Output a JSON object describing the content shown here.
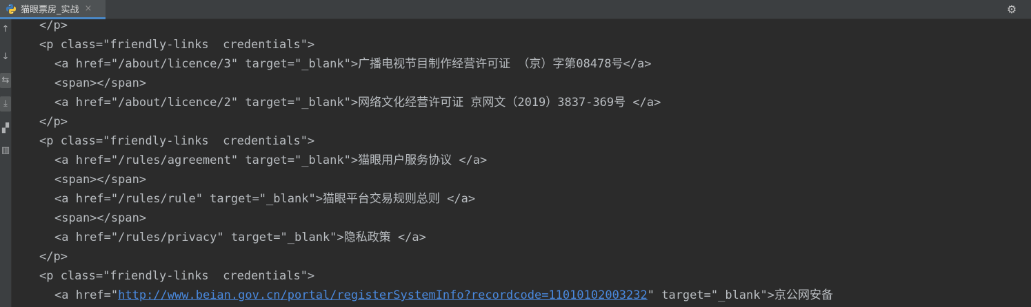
{
  "tab": {
    "title": "猫眼票房_实战",
    "close": "×",
    "icon": "python-icon"
  },
  "toolbar": {
    "settings_icon": "⚙"
  },
  "sidebar": {
    "buttons": [
      {
        "name": "scroll-up-icon",
        "glyph": "↑"
      },
      {
        "name": "scroll-down-icon",
        "glyph": "↓"
      },
      {
        "name": "soft-wrap-icon",
        "glyph": "⇆"
      },
      {
        "name": "scroll-to-end-icon",
        "glyph": "⤓"
      },
      {
        "name": "print-icon",
        "glyph": "▞"
      },
      {
        "name": "trash-icon",
        "glyph": "▥"
      }
    ]
  },
  "console": {
    "lines": [
      "</p>",
      "<p class=\"friendly-links  credentials\">",
      "<a href=\"/about/licence/3\" target=\"_blank\">广播电视节目制作经营许可证 （京）字第08478号</a>",
      "<span></span>",
      "<a href=\"/about/licence/2\" target=\"_blank\">网络文化经营许可证 京网文（2019）3837-369号 </a>",
      "</p>",
      "<p class=\"friendly-links  credentials\">",
      "<a href=\"/rules/agreement\" target=\"_blank\">猫眼用户服务协议 </a>",
      "<span></span>",
      "<a href=\"/rules/rule\" target=\"_blank\">猫眼平台交易规则总则 </a>",
      "<span></span>",
      "<a href=\"/rules/privacy\" target=\"_blank\">隐私政策 </a>",
      "</p>",
      "<p class=\"friendly-links  credentials\">"
    ],
    "last_line": {
      "prefix": "<a href=\"",
      "link": "http://www.beian.gov.cn/portal/registerSystemInfo?recordcode=11010102003232",
      "suffix": "\" target=\"_blank\">京公网安备"
    }
  },
  "colors": {
    "background": "#2b2b2b",
    "text": "#b9bdc1",
    "link": "#4a8ae0",
    "tab_accent": "#4a88c7"
  }
}
